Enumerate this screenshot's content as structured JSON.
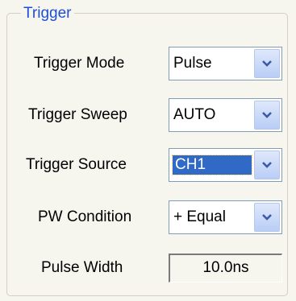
{
  "group": {
    "title": "Trigger"
  },
  "rows": [
    {
      "label": "Trigger Mode",
      "value": "Pulse"
    },
    {
      "label": "Trigger Sweep",
      "value": "AUTO"
    },
    {
      "label": "Trigger Source",
      "value": "CH1"
    },
    {
      "label": "PW Condition",
      "value": "+ Equal"
    }
  ],
  "pulse_width": {
    "label": "Pulse Width",
    "value": "10.0ns"
  },
  "icons": {
    "dropdown": "chevron-down-icon"
  },
  "colors": {
    "group_title": "#1f4fd6",
    "selection": "#3169c6",
    "combo_border": "#7f9db9"
  }
}
